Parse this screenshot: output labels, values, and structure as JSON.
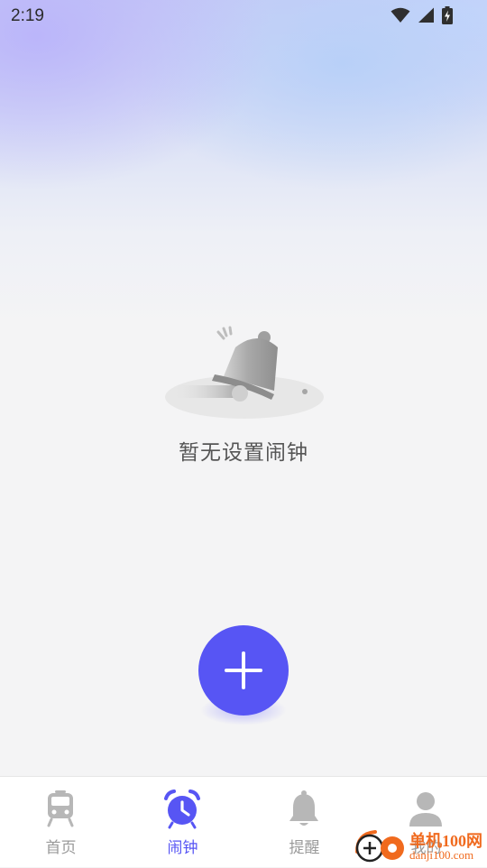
{
  "status_bar": {
    "time": "2:19",
    "icons": [
      "wifi-icon",
      "cellular-signal-icon",
      "battery-charging-icon"
    ]
  },
  "empty_state": {
    "illustration": "bell-icon",
    "message": "暂无设置闹钟"
  },
  "fab": {
    "icon": "plus-icon"
  },
  "tab_bar": {
    "active_index": 1,
    "items": [
      {
        "label": "首页",
        "icon": "train-icon"
      },
      {
        "label": "闹钟",
        "icon": "alarm-clock-icon"
      },
      {
        "label": "提醒",
        "icon": "bell-icon"
      },
      {
        "label": "我的",
        "icon": "user-icon"
      }
    ]
  },
  "watermark": {
    "name": "单机100网",
    "domain": "danji100.com"
  },
  "colors": {
    "accent": "#5755f4",
    "tab_inactive": "#9a9a9a",
    "watermark": "#f06a1e"
  }
}
